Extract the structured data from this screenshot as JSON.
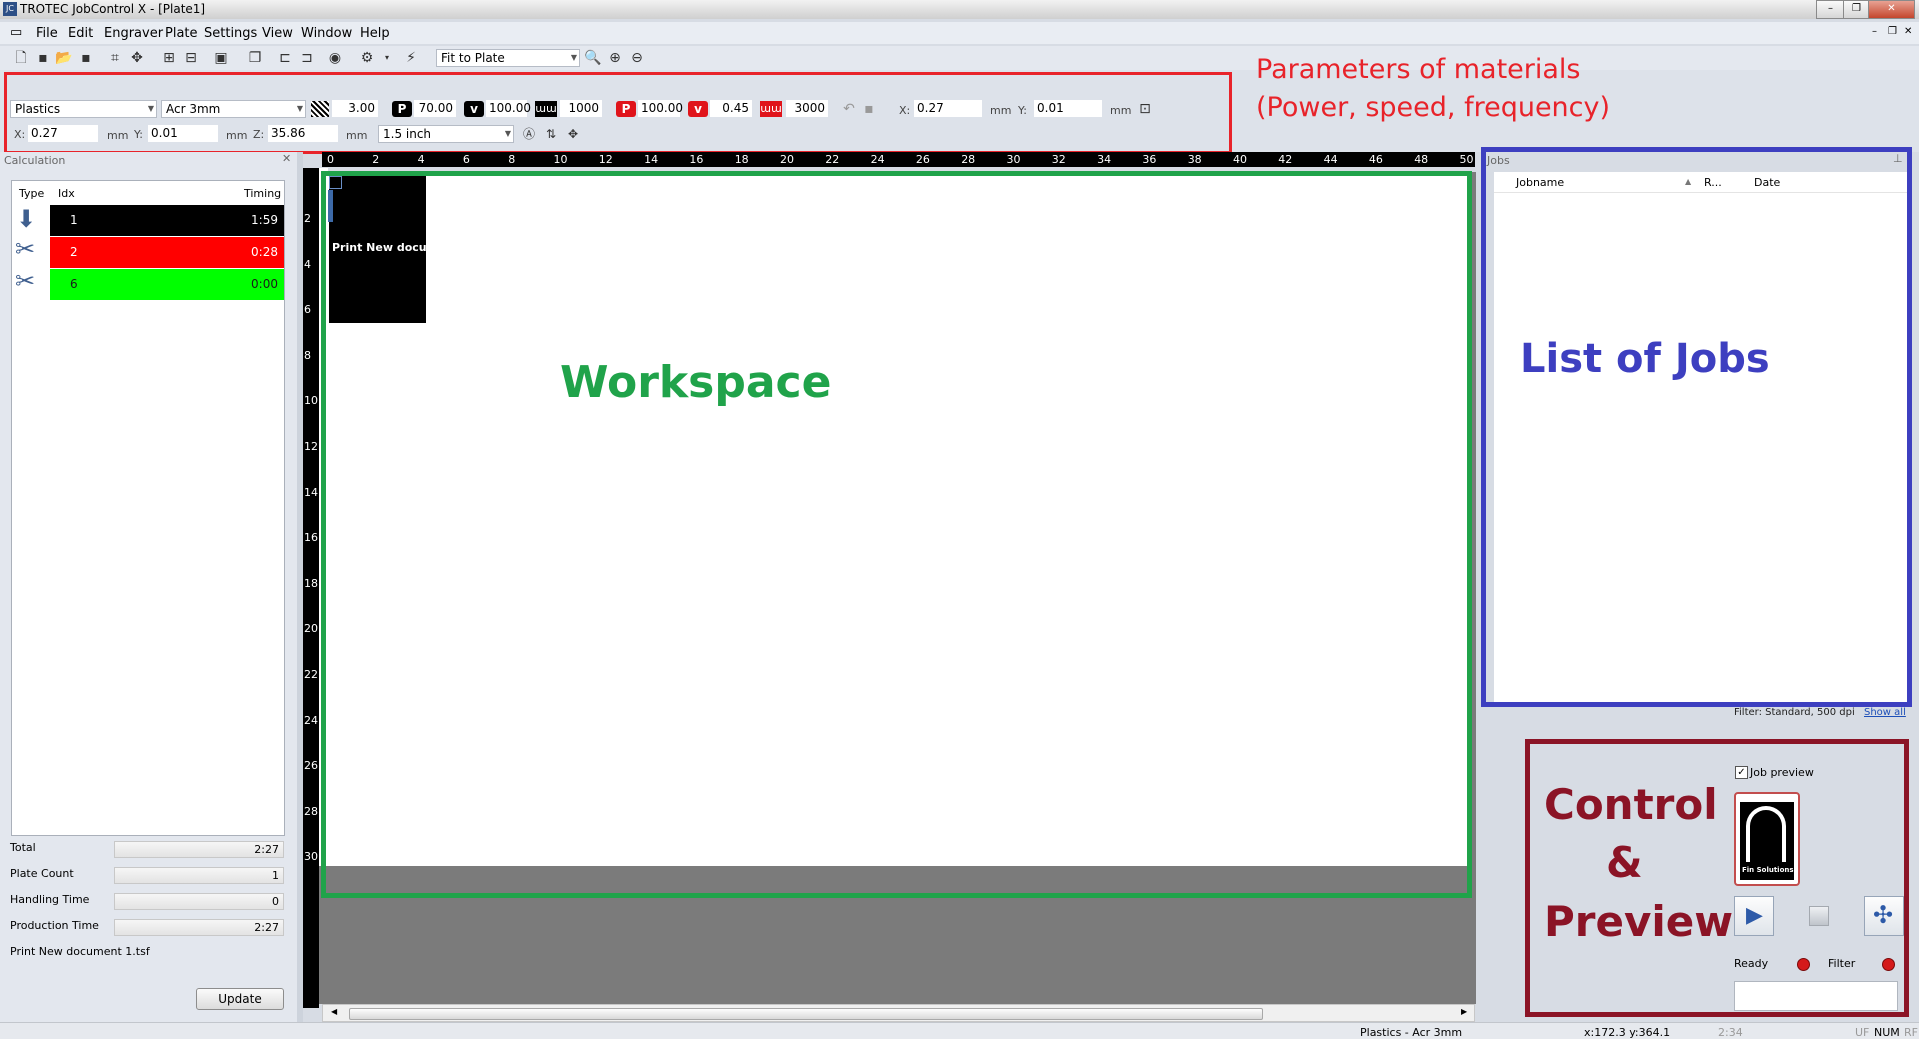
{
  "window": {
    "title": "TROTEC JobControl X - [Plate1]",
    "app_icon": "jc-app-icon"
  },
  "menu": {
    "items": [
      "File",
      "Edit",
      "Engraver",
      "Plate",
      "Settings",
      "View",
      "Window",
      "Help"
    ]
  },
  "toolbar": {
    "zoom_mode": "Fit to Plate"
  },
  "parameters": {
    "material_group": "Plastics",
    "material": "Acr 3mm",
    "thickness": "3.00",
    "power_black": "70.00",
    "speed_black": "100.00",
    "freq_black": "1000",
    "power_red": "100.00",
    "speed_red": "0.45",
    "freq_red": "3000",
    "pos_x": "0.27",
    "pos_y": "0.01",
    "unit": "mm",
    "x_label": "X:",
    "y_label": "Y:",
    "z_label": "Z:",
    "pos2_x": "0.27",
    "pos2_y": "0.01",
    "pos2_z": "35.86",
    "lens": "1.5 inch",
    "p_badge": "P",
    "v_badge": "v"
  },
  "annotations": {
    "params_title": "Parameters of materials",
    "params_subtitle": "(Power, speed, frequency)",
    "workspace": "Workspace",
    "jobs": "List of Jobs",
    "control_line1": "Control",
    "control_line2": "&",
    "control_line3": "Preview",
    "color_red": "#e8232a",
    "color_green": "#20a34a",
    "color_blue": "#3d3fc0",
    "color_maroon": "#8b1426"
  },
  "calculation": {
    "title": "Calculation",
    "col_type": "Type",
    "col_idx": "Idx",
    "col_timing": "Timing",
    "rows": [
      {
        "idx": "1",
        "timing": "1:59",
        "color": "#000000",
        "text_color": "#ffffff",
        "icon": "engrave-icon"
      },
      {
        "idx": "2",
        "timing": "0:28",
        "color": "#ff0000",
        "text_color": "#ffffff",
        "icon": "scissors-icon"
      },
      {
        "idx": "6",
        "timing": "0:00",
        "color": "#00ff00",
        "text_color": "#1a1a1a",
        "icon": "scissors-icon"
      }
    ],
    "total_label": "Total",
    "total": "2:27",
    "plate_count_label": "Plate Count",
    "plate_count": "1",
    "handling_label": "Handling Time",
    "handling": "0",
    "production_label": "Production Time",
    "production": "2:27",
    "filename": "Print New document 1.tsf",
    "update": "Update"
  },
  "ruler": {
    "top": [
      "0",
      "2",
      "4",
      "6",
      "8",
      "10",
      "12",
      "14",
      "16",
      "18",
      "20",
      "22",
      "24",
      "26",
      "28",
      "30",
      "32",
      "34",
      "36",
      "38",
      "40",
      "42",
      "44",
      "46",
      "48",
      "50"
    ],
    "left": [
      "2",
      "4",
      "6",
      "8",
      "10",
      "12",
      "14",
      "16",
      "18",
      "20",
      "22",
      "24",
      "26",
      "28",
      "30"
    ]
  },
  "canvas": {
    "job_label": "Print New docum"
  },
  "jobs": {
    "title": "Jobs",
    "col_jobname": "Jobname",
    "col_r": "R...",
    "col_date": "Date",
    "filter_text": "Filter: Standard, 500 dpi",
    "show_all": "Show all"
  },
  "control": {
    "job_preview": "Job preview",
    "logo_text": "Fin Solutions",
    "ready": "Ready",
    "filter": "Filter"
  },
  "status": {
    "material": "Plastics - Acr 3mm",
    "coords": "x:172.3   y:364.1",
    "time": "2:34",
    "flags": [
      "UF",
      "NUM",
      "RF"
    ]
  }
}
